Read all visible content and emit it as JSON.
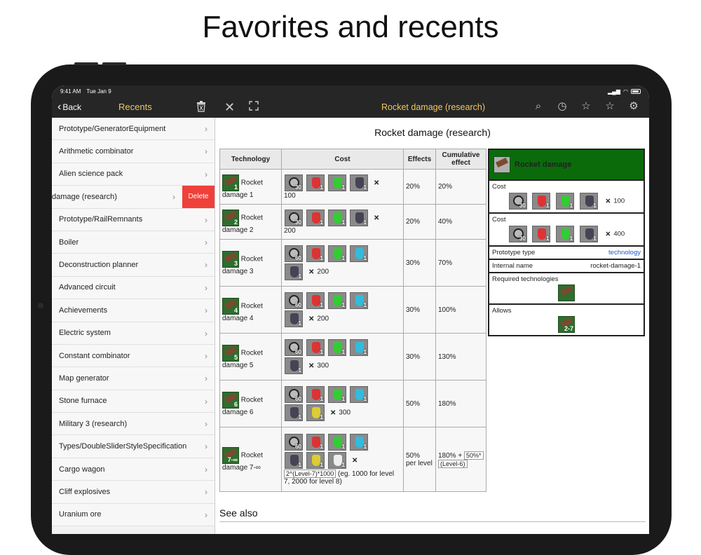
{
  "headline": "Favorites and recents",
  "status": {
    "time": "9:41 AM",
    "date": "Tue Jan 9"
  },
  "nav": {
    "back_label": "Back",
    "sidebar_title": "Recents",
    "page_title": "Rocket damage (research)"
  },
  "sidebar": {
    "items": [
      {
        "label": "Prototype/GeneratorEquipment"
      },
      {
        "label": "Arithmetic combinator"
      },
      {
        "label": "Alien science pack"
      },
      {
        "label": "damage (research)",
        "delete_label": "Delete"
      },
      {
        "label": "Prototype/RailRemnants"
      },
      {
        "label": "Boiler"
      },
      {
        "label": "Deconstruction planner"
      },
      {
        "label": "Advanced circuit"
      },
      {
        "label": "Achievements"
      },
      {
        "label": "Electric system"
      },
      {
        "label": "Constant combinator"
      },
      {
        "label": "Map generator"
      },
      {
        "label": "Stone furnace"
      },
      {
        "label": "Military 3 (research)"
      },
      {
        "label": "Types/DoubleSliderStyleSpecification"
      },
      {
        "label": "Cargo wagon"
      },
      {
        "label": "Cliff explosives"
      },
      {
        "label": "Uranium ore"
      }
    ]
  },
  "content": {
    "heading": "Rocket damage (research)",
    "table": {
      "headers": [
        "Technology",
        "Cost",
        "Effects",
        "Cumulative effect"
      ],
      "rows": [
        {
          "level": "1",
          "name_a": "Rocket",
          "name_b": "damage 1",
          "time": "30",
          "amount": "100",
          "effect": "20%",
          "cumulative": "20%"
        },
        {
          "level": "2",
          "name_a": "Rocket",
          "name_b": "damage 2",
          "time": "30",
          "amount": "200",
          "effect": "20%",
          "cumulative": "40%"
        },
        {
          "level": "3",
          "name_a": "Rocket",
          "name_b": "damage 3",
          "time": "60",
          "amount": "200",
          "effect": "30%",
          "cumulative": "70%"
        },
        {
          "level": "4",
          "name_a": "Rocket",
          "name_b": "damage 4",
          "time": "60",
          "amount": "200",
          "effect": "30%",
          "cumulative": "100%"
        },
        {
          "level": "5",
          "name_a": "Rocket",
          "name_b": "damage 5",
          "time": "60",
          "amount": "300",
          "effect": "30%",
          "cumulative": "130%"
        },
        {
          "level": "6",
          "name_a": "Rocket",
          "name_b": "damage 6",
          "time": "60",
          "amount": "300",
          "effect": "50%",
          "cumulative": "180%"
        },
        {
          "level": "7-∞",
          "name_a": "Rocket",
          "name_b": "damage 7-∞",
          "time": "60",
          "formula": "2^(Level-7)*1000",
          "formula_note": "(eg. 1000 for level 7, 2000 for level 8)",
          "effect_a": "50%",
          "effect_b": "per level",
          "cumulative_a": "180% +",
          "cumulative_box": "50%*",
          "cumulative_note": "(Level-6)"
        }
      ]
    },
    "infobox": {
      "title": "Rocket damage",
      "cost1_label": "Cost",
      "cost1_amount": "100",
      "cost1_time": "30",
      "cost2_label": "Cost",
      "cost2_amount": "400",
      "cost2_time": "30",
      "prototype_type_label": "Prototype type",
      "prototype_type_value": "technology",
      "internal_name_label": "Internal name",
      "internal_name_value": "rocket-damage-1",
      "required_label": "Required technologies",
      "allows_label": "Allows",
      "allows_level": "2-7"
    },
    "see_also": "See also"
  },
  "colors": {
    "accent": "#f0c75e",
    "delete": "#f0403a",
    "infobox_header": "#0b6b0b"
  }
}
